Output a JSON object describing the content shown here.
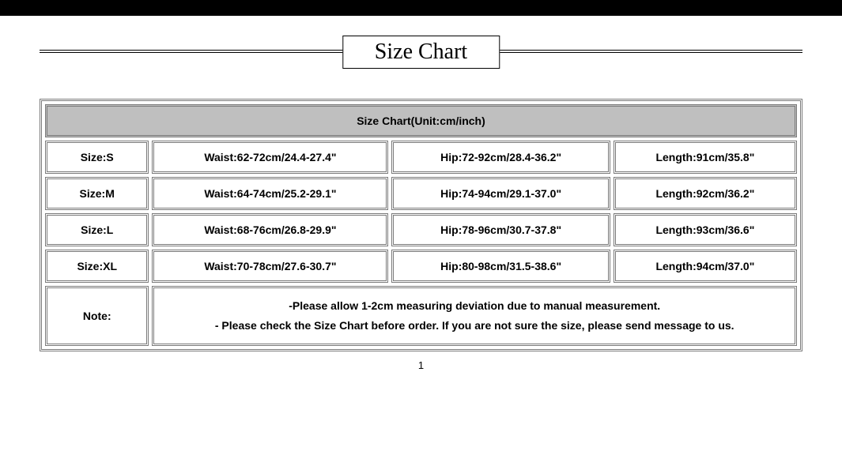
{
  "title": "Size Chart",
  "header": "Size Chart(Unit:cm/inch)",
  "rows": [
    {
      "size": "Size:S",
      "waist": "Waist:62-72cm/24.4-27.4\"",
      "hip": "Hip:72-92cm/28.4-36.2\"",
      "length": "Length:91cm/35.8\""
    },
    {
      "size": "Size:M",
      "waist": "Waist:64-74cm/25.2-29.1\"",
      "hip": "Hip:74-94cm/29.1-37.0\"",
      "length": "Length:92cm/36.2\""
    },
    {
      "size": "Size:L",
      "waist": "Waist:68-76cm/26.8-29.9\"",
      "hip": "Hip:78-96cm/30.7-37.8\"",
      "length": "Length:93cm/36.6\""
    },
    {
      "size": "Size:XL",
      "waist": "Waist:70-78cm/27.6-30.7\"",
      "hip": "Hip:80-98cm/31.5-38.6\"",
      "length": "Length:94cm/37.0\""
    }
  ],
  "noteLabel": "Note:",
  "noteLine1": "-Please allow 1-2cm measuring deviation due to manual measurement.",
  "noteLine2": "- Please check the Size Chart before order. If you are not sure the size, please send message to us.",
  "pageNumber": "1"
}
